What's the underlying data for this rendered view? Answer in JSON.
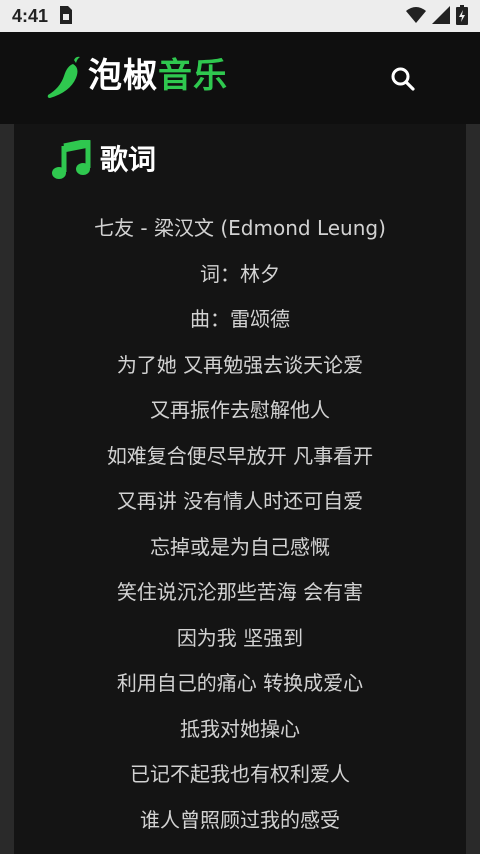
{
  "status_bar": {
    "time": "4:41",
    "icons": [
      "sim-card-icon",
      "wifi-icon",
      "signal-icon",
      "battery-icon"
    ]
  },
  "app_bar": {
    "brand_part1": "泡椒",
    "brand_part2": "音乐",
    "logo_icon": "chili-pepper-icon",
    "search_icon": "search-icon"
  },
  "section": {
    "icon": "music-note-icon",
    "title": "歌词"
  },
  "lyrics": [
    "七友 - 梁汉文 (Edmond Leung)",
    "词：林夕",
    "曲：雷颂德",
    "为了她 又再勉强去谈天论爱",
    "又再振作去慰解他人",
    "如难复合便尽早放开 凡事看开",
    "又再讲 没有情人时还可自爱",
    "忘掉或是为自己感慨",
    "笑住说沉沦那些苦海 会有害",
    "因为我 坚强到",
    "利用自己的痛心 转换成爱心",
    "抵我对她操心",
    "已记不起我也有权利爱人",
    "谁人曾照顾过我的感受"
  ],
  "colors": {
    "accent": "#2fc84f",
    "background": "#121212",
    "text": "#d2d2d2",
    "status_bar": "#ededed"
  }
}
